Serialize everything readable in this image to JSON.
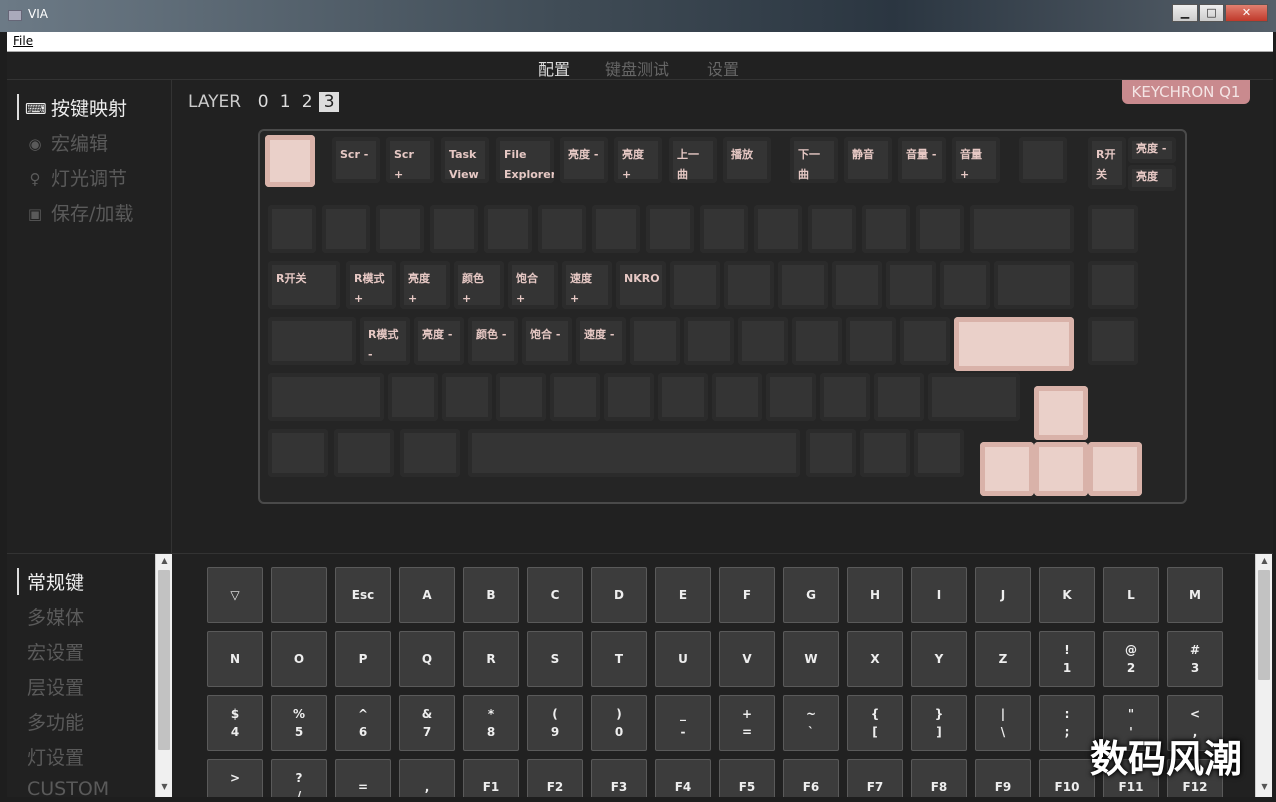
{
  "window": {
    "title": "VIA",
    "controls": [
      "▁",
      "□",
      "✕"
    ]
  },
  "menu": {
    "file": "File"
  },
  "topnav": {
    "tabs": [
      "配置",
      "键盘测试",
      "设置"
    ],
    "active": 0
  },
  "sidebar": {
    "items": [
      {
        "icon": "keyboard-icon",
        "label": "按键映射"
      },
      {
        "icon": "target-icon",
        "label": "宏编辑"
      },
      {
        "icon": "lightbulb-icon",
        "label": "灯光调节"
      },
      {
        "icon": "floppy-disk-icon",
        "label": "保存/加载"
      }
    ]
  },
  "layers": {
    "label": "LAYER",
    "items": [
      "0",
      "1",
      "2",
      "3"
    ],
    "active": 3
  },
  "keyboard_name": "KEYCHRON Q1",
  "keyboard": {
    "keys": [
      {
        "label": "",
        "hl": true
      },
      {
        "label": "Scr -"
      },
      {
        "label": "Scr +"
      },
      {
        "label": "Task View"
      },
      {
        "label": "File Explorer"
      },
      {
        "label": "亮度 -"
      },
      {
        "label": "亮度 +"
      },
      {
        "label": "上一曲"
      },
      {
        "label": "播放"
      },
      {
        "label": "下一曲"
      },
      {
        "label": "静音"
      },
      {
        "label": "音量 -"
      },
      {
        "label": "音量 +"
      },
      {
        "label": ""
      },
      {
        "label": "R开关"
      },
      {
        "label": "亮度 -"
      },
      {
        "label": "亮度 +"
      },
      {
        "label": ""
      },
      {
        "label": ""
      },
      {
        "label": ""
      },
      {
        "label": ""
      },
      {
        "label": ""
      },
      {
        "label": ""
      },
      {
        "label": ""
      },
      {
        "label": ""
      },
      {
        "label": ""
      },
      {
        "label": ""
      },
      {
        "label": ""
      },
      {
        "label": ""
      },
      {
        "label": ""
      },
      {
        "label": ""
      },
      {
        "label": ""
      },
      {
        "label": "R开关"
      },
      {
        "label": "R模式 +"
      },
      {
        "label": "亮度 +"
      },
      {
        "label": "颜色 +"
      },
      {
        "label": "饱合 +"
      },
      {
        "label": "速度 +"
      },
      {
        "label": "NKRO"
      },
      {
        "label": ""
      },
      {
        "label": ""
      },
      {
        "label": ""
      },
      {
        "label": ""
      },
      {
        "label": ""
      },
      {
        "label": ""
      },
      {
        "label": ""
      },
      {
        "label": ""
      },
      {
        "label": ""
      },
      {
        "label": "R模式 -"
      },
      {
        "label": "亮度 -"
      },
      {
        "label": "颜色 -"
      },
      {
        "label": "饱合 -"
      },
      {
        "label": "速度 -"
      },
      {
        "label": ""
      },
      {
        "label": ""
      },
      {
        "label": ""
      },
      {
        "label": ""
      },
      {
        "label": ""
      },
      {
        "label": ""
      },
      {
        "label": "",
        "hl": true
      },
      {
        "label": ""
      },
      {
        "label": ""
      },
      {
        "label": ""
      },
      {
        "label": ""
      },
      {
        "label": ""
      },
      {
        "label": ""
      },
      {
        "label": ""
      },
      {
        "label": ""
      },
      {
        "label": ""
      },
      {
        "label": ""
      },
      {
        "label": ""
      },
      {
        "label": ""
      },
      {
        "label": ""
      },
      {
        "label": "",
        "hl": true
      },
      {
        "label": ""
      },
      {
        "label": ""
      },
      {
        "label": ""
      },
      {
        "label": ""
      },
      {
        "label": ""
      },
      {
        "label": ""
      },
      {
        "label": ""
      },
      {
        "label": "",
        "hl": true
      },
      {
        "label": "",
        "hl": true
      },
      {
        "label": "",
        "hl": true
      }
    ]
  },
  "categories": {
    "items": [
      "常规键",
      "多媒体",
      "宏设置",
      "层设置",
      "多功能",
      "灯设置",
      "CUSTOM"
    ],
    "active": 0
  },
  "palette": {
    "keys": [
      "▽",
      "",
      "Esc",
      "A",
      "B",
      "C",
      "D",
      "E",
      "F",
      "G",
      "H",
      "I",
      "J",
      "K",
      "L",
      "M",
      "N",
      "O",
      "P",
      "Q",
      "R",
      "S",
      "T",
      "U",
      "V",
      "W",
      "X",
      "Y",
      "Z",
      "!\n1",
      "@\n2",
      "#\n3",
      "$\n4",
      "%\n5",
      "^\n6",
      "&\n7",
      "*\n8",
      "(\n9",
      ")\n0",
      "_\n-",
      "+\n=",
      "~\n`",
      "{\n[",
      "}\n]",
      "|\n\\",
      ":\n;",
      "\"\n'",
      "<\n,",
      ">\n.",
      "?\n/",
      "=",
      ",",
      "F1",
      "F2",
      "F3",
      "F4",
      "F5",
      "F6",
      "F7",
      "F8",
      "F9",
      "F10",
      "F11",
      "F12"
    ]
  },
  "watermark": "数码风潮",
  "colors": {
    "accent": "#c98a8e",
    "key_highlight": "#ead0c9",
    "background": "#212121"
  }
}
